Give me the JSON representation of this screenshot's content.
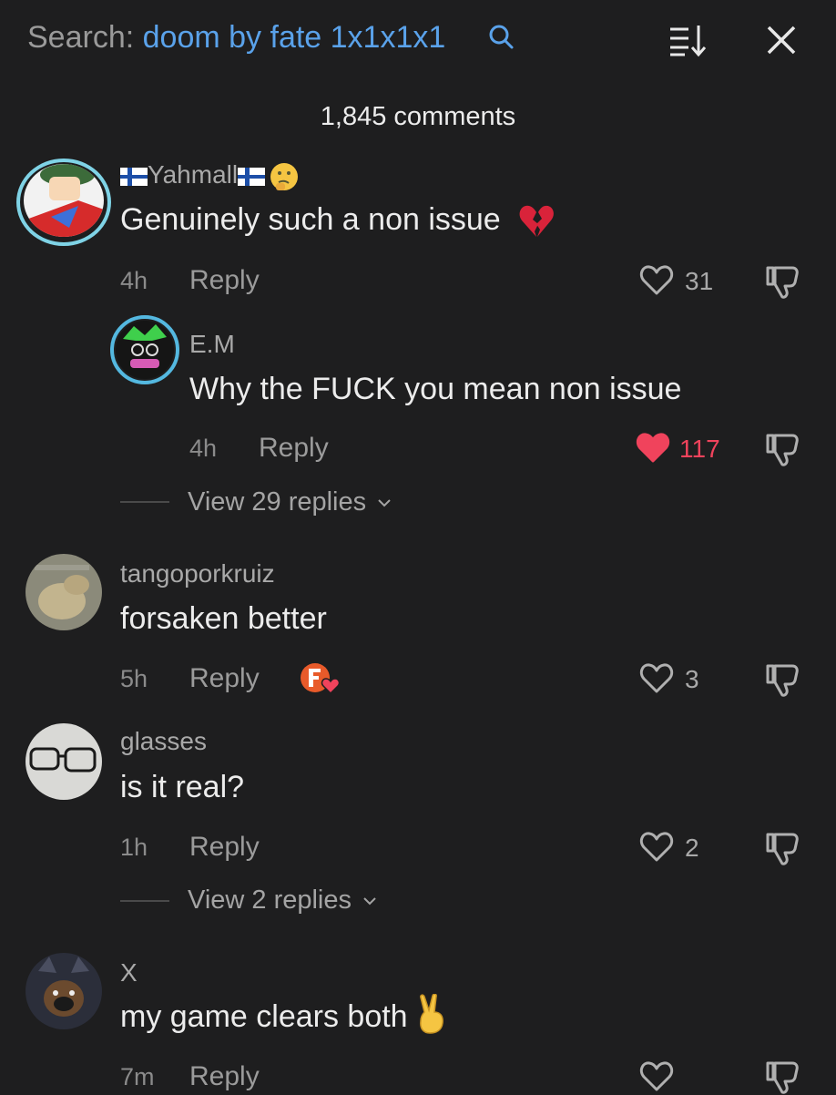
{
  "header": {
    "search_label": "Search:",
    "search_query": "doom by fate 1x1x1x1",
    "comment_count": "1,845 comments"
  },
  "comments": [
    {
      "username": "Yahmall",
      "text": "Genuinely such a non issue",
      "time": "4h",
      "reply": "Reply",
      "likes": "31",
      "liked": false
    },
    {
      "username": "E.M",
      "text": "Why the FUCK you mean non issue",
      "time": "4h",
      "reply": "Reply",
      "likes": "117",
      "liked": true,
      "view_replies": "View 29 replies"
    },
    {
      "username": "tangoporkruiz",
      "text": "forsaken better",
      "time": "5h",
      "reply": "Reply",
      "likes": "3",
      "liked": false
    },
    {
      "username": "glasses",
      "text": "is it real?",
      "time": "1h",
      "reply": "Reply",
      "likes": "2",
      "liked": false,
      "view_replies": "View 2 replies"
    },
    {
      "username": "X",
      "text": "my game clears both",
      "time": "7m",
      "reply": "Reply",
      "likes": "",
      "liked": false
    }
  ],
  "colors": {
    "background": "#1e1e1f",
    "accent_blue": "#5aa2ea",
    "like_red": "#f0435c"
  },
  "icons": [
    "search-icon",
    "sort-icon",
    "close-icon",
    "heart-icon",
    "dislike-icon",
    "chevron-down-icon"
  ]
}
